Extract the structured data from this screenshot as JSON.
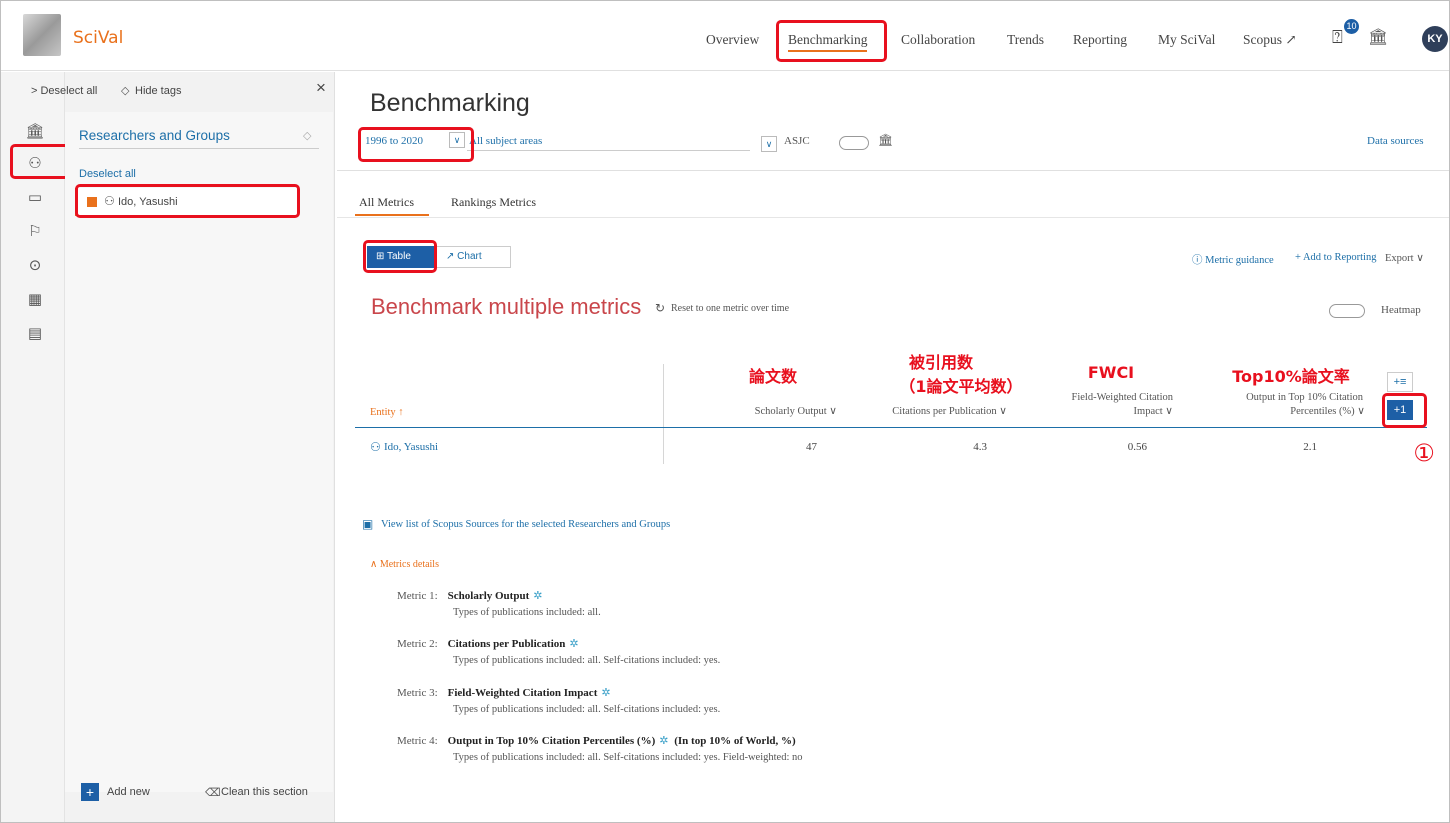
{
  "app": {
    "name": "SciVal"
  },
  "nav": {
    "items": [
      "Overview",
      "Benchmarking",
      "Collaboration",
      "Trends",
      "Reporting",
      "My SciVal",
      "Scopus ↗"
    ],
    "active": "Benchmarking",
    "help_badge": "10",
    "avatar": "KY"
  },
  "sidebar": {
    "deselect_all_top": "> Deselect all",
    "hide_tags": "Hide tags",
    "close": "×",
    "section_title": "Researchers and Groups",
    "deselect_all": "Deselect all",
    "entity": "Ido, Yasushi",
    "add_new": "Add new",
    "clean_section": "Clean this section"
  },
  "main": {
    "title": "Benchmarking",
    "year_range": "1996 to 2020",
    "subject_areas": "All subject areas",
    "asjc": "ASJC",
    "data_sources": "Data sources",
    "tabs": [
      "All Metrics",
      "Rankings Metrics"
    ],
    "view_table": "Table",
    "view_chart": "Chart",
    "metric_guidance": "Metric guidance",
    "add_to_reporting": "Add to Reporting",
    "export": "Export",
    "section_title": "Benchmark multiple metrics",
    "reset_link": "Reset to one metric over time",
    "heatmap": "Heatmap",
    "view_sources_link": "View list of Scopus Sources for the selected Researchers and Groups",
    "metrics_details": "Metrics details"
  },
  "table": {
    "entity_header": "Entity ↑",
    "columns": [
      {
        "label": "Scholarly Output ∨"
      },
      {
        "label": "Citations per Publication ∨"
      },
      {
        "label1": "Field-Weighted Citation",
        "label2": "Impact ∨"
      },
      {
        "label1": "Output in Top 10% Citation",
        "label2": "Percentiles (%) ∨"
      }
    ],
    "add_column": "+1",
    "rows": [
      {
        "entity": "Ido, Yasushi",
        "values": [
          "47",
          "4.3",
          "0.56",
          "2.1"
        ]
      }
    ]
  },
  "annotations": {
    "col1": "論文数",
    "col2_line1": "被引用数",
    "col2_line2": "（1論文平均数）",
    "col3": "FWCI",
    "col4": "Top10%論文率",
    "step": "①"
  },
  "metrics": [
    {
      "label": "Metric 1:",
      "name": "Scholarly Output",
      "extra": "",
      "sub": "Types of publications included: all."
    },
    {
      "label": "Metric 2:",
      "name": "Citations per Publication",
      "extra": "",
      "sub": "Types of publications included: all.   Self-citations included: yes."
    },
    {
      "label": "Metric 3:",
      "name": "Field-Weighted Citation Impact",
      "extra": "",
      "sub": "Types of publications included: all.   Self-citations included: yes."
    },
    {
      "label": "Metric 4:",
      "name": "Output in Top 10% Citation Percentiles (%)",
      "extra": "(In top 10% of World, %)",
      "sub": "Types of publications included: all.   Self-citations included: yes.   Field-weighted: no"
    }
  ]
}
